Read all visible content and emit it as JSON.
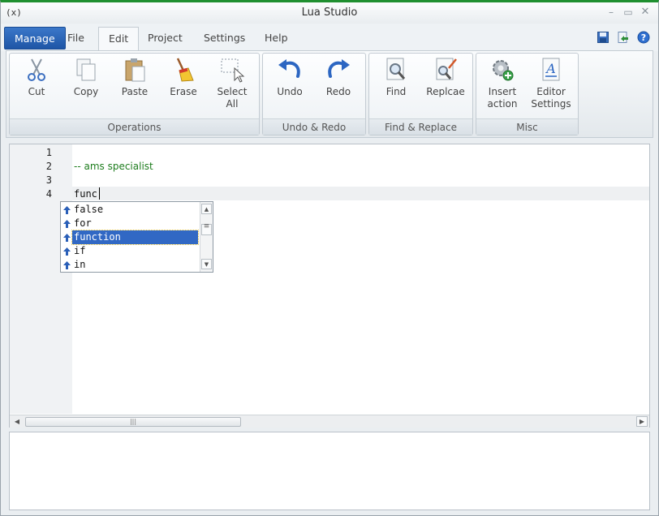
{
  "window": {
    "app_icon_text": "(x)",
    "title": "Lua Studio",
    "minimize": "–",
    "maximize": "▭",
    "close": "✕"
  },
  "menu": {
    "tabs": [
      {
        "label": "Manage"
      },
      {
        "label": "File"
      },
      {
        "label": "Edit"
      },
      {
        "label": "Project"
      },
      {
        "label": "Settings"
      },
      {
        "label": "Help"
      }
    ],
    "active_tab": "Edit"
  },
  "ribbon": {
    "groups": [
      {
        "label": "Operations",
        "buttons": [
          {
            "label": "Cut",
            "icon": "scissors-icon"
          },
          {
            "label": "Copy",
            "icon": "copy-icon"
          },
          {
            "label": "Paste",
            "icon": "paste-icon"
          },
          {
            "label": "Erase",
            "icon": "broom-icon"
          },
          {
            "label": "Select",
            "label2": "All",
            "icon": "select-all-icon"
          }
        ]
      },
      {
        "label": "Undo & Redo",
        "buttons": [
          {
            "label": "Undo",
            "icon": "undo-icon"
          },
          {
            "label": "Redo",
            "icon": "redo-icon"
          }
        ]
      },
      {
        "label": "Find & Replace",
        "buttons": [
          {
            "label": "Find",
            "icon": "find-icon"
          },
          {
            "label": "Replcae",
            "icon": "replace-icon"
          }
        ]
      },
      {
        "label": "Misc",
        "buttons": [
          {
            "label": "Insert",
            "label2": "action",
            "icon": "insert-action-icon"
          },
          {
            "label": "Editor",
            "label2": "Settings",
            "icon": "editor-settings-icon"
          }
        ]
      }
    ]
  },
  "editor": {
    "line_numbers": [
      "1",
      "2",
      "3",
      "4"
    ],
    "lines": [
      "",
      "-- ams specialist",
      "",
      "func"
    ],
    "autocomplete": {
      "items": [
        "false",
        "for",
        "function",
        "if",
        "in"
      ],
      "selected": "function"
    }
  },
  "colors": {
    "accent": "#1e55a6",
    "selection": "#3168c4",
    "comment": "#1e7d1e",
    "title_border": "#1f8f30"
  }
}
